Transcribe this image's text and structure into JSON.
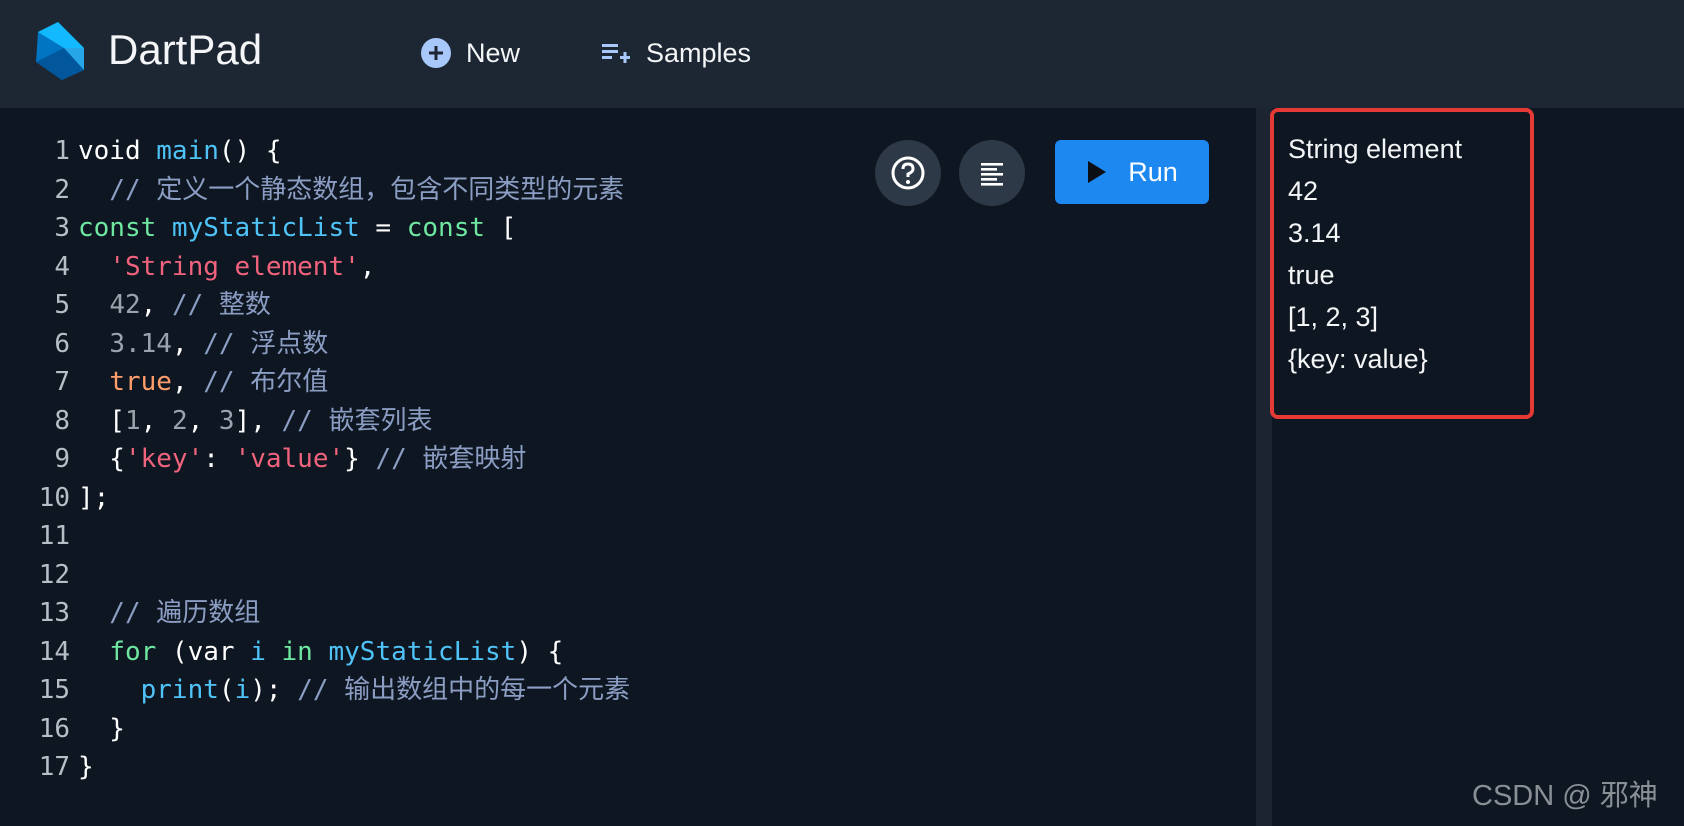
{
  "header": {
    "title": "DartPad",
    "new_label": "New",
    "samples_label": "Samples"
  },
  "toolbar": {
    "run_label": "Run"
  },
  "editor": {
    "line_numbers": [
      "1",
      "2",
      "3",
      "4",
      "5",
      "6",
      "7",
      "8",
      "9",
      "10",
      "11",
      "12",
      "13",
      "14",
      "15",
      "16",
      "17"
    ],
    "lines": [
      [
        {
          "t": "void ",
          "c": "p"
        },
        {
          "t": "main",
          "c": "f"
        },
        {
          "t": "() {",
          "c": "p"
        }
      ],
      [
        {
          "t": "  // 定义一个静态数组，包含不同类型的元素",
          "c": "c"
        }
      ],
      [
        {
          "t": "const ",
          "c": "k"
        },
        {
          "t": "myStaticList",
          "c": "f"
        },
        {
          "t": " = ",
          "c": "p"
        },
        {
          "t": "const",
          "c": "k"
        },
        {
          "t": " [",
          "c": "p"
        }
      ],
      [
        {
          "t": "  ",
          "c": "p"
        },
        {
          "t": "'String element'",
          "c": "s"
        },
        {
          "t": ",",
          "c": "p"
        }
      ],
      [
        {
          "t": "  ",
          "c": "p"
        },
        {
          "t": "42",
          "c": "n"
        },
        {
          "t": ", ",
          "c": "p"
        },
        {
          "t": "// 整数",
          "c": "c"
        }
      ],
      [
        {
          "t": "  ",
          "c": "p"
        },
        {
          "t": "3.14",
          "c": "n"
        },
        {
          "t": ", ",
          "c": "p"
        },
        {
          "t": "// 浮点数",
          "c": "c"
        }
      ],
      [
        {
          "t": "  ",
          "c": "p"
        },
        {
          "t": "true",
          "c": "b"
        },
        {
          "t": ", ",
          "c": "p"
        },
        {
          "t": "// 布尔值",
          "c": "c"
        }
      ],
      [
        {
          "t": "  [",
          "c": "p"
        },
        {
          "t": "1",
          "c": "n"
        },
        {
          "t": ", ",
          "c": "p"
        },
        {
          "t": "2",
          "c": "n"
        },
        {
          "t": ", ",
          "c": "p"
        },
        {
          "t": "3",
          "c": "n"
        },
        {
          "t": "], ",
          "c": "p"
        },
        {
          "t": "// 嵌套列表",
          "c": "c"
        }
      ],
      [
        {
          "t": "  {",
          "c": "p"
        },
        {
          "t": "'key'",
          "c": "s"
        },
        {
          "t": ": ",
          "c": "p"
        },
        {
          "t": "'value'",
          "c": "s"
        },
        {
          "t": "} ",
          "c": "p"
        },
        {
          "t": "// 嵌套映射",
          "c": "c"
        }
      ],
      [
        {
          "t": "];",
          "c": "p"
        }
      ],
      [
        {
          "t": "",
          "c": "p"
        }
      ],
      [
        {
          "t": "",
          "c": "p"
        }
      ],
      [
        {
          "t": "  // 遍历数组",
          "c": "c"
        }
      ],
      [
        {
          "t": "  ",
          "c": "p"
        },
        {
          "t": "for",
          "c": "k"
        },
        {
          "t": " (var ",
          "c": "p"
        },
        {
          "t": "i",
          "c": "f"
        },
        {
          "t": " in ",
          "c": "k"
        },
        {
          "t": "myStaticList",
          "c": "f"
        },
        {
          "t": ") {",
          "c": "p"
        }
      ],
      [
        {
          "t": "    ",
          "c": "p"
        },
        {
          "t": "print",
          "c": "f"
        },
        {
          "t": "(",
          "c": "p"
        },
        {
          "t": "i",
          "c": "f"
        },
        {
          "t": "); ",
          "c": "p"
        },
        {
          "t": "// 输出数组中的每一个元素",
          "c": "c"
        }
      ],
      [
        {
          "t": "  }",
          "c": "p"
        }
      ],
      [
        {
          "t": "}",
          "c": "p"
        }
      ]
    ]
  },
  "output": {
    "lines": [
      "String element",
      "42",
      "3.14",
      "true",
      "[1, 2, 3]",
      "{key: value}"
    ]
  },
  "watermark": "CSDN @ 邪神",
  "colors": {
    "header_bg": "#1d2733",
    "editor_bg": "#0e1621",
    "run_button": "#1e88f1",
    "highlight_box": "#e53935"
  },
  "icons": {
    "logo": "dart-logo-icon",
    "new": "add-circle-icon",
    "samples": "playlist-add-icon",
    "help": "help-icon",
    "format": "format-align-icon",
    "run": "play-icon"
  }
}
